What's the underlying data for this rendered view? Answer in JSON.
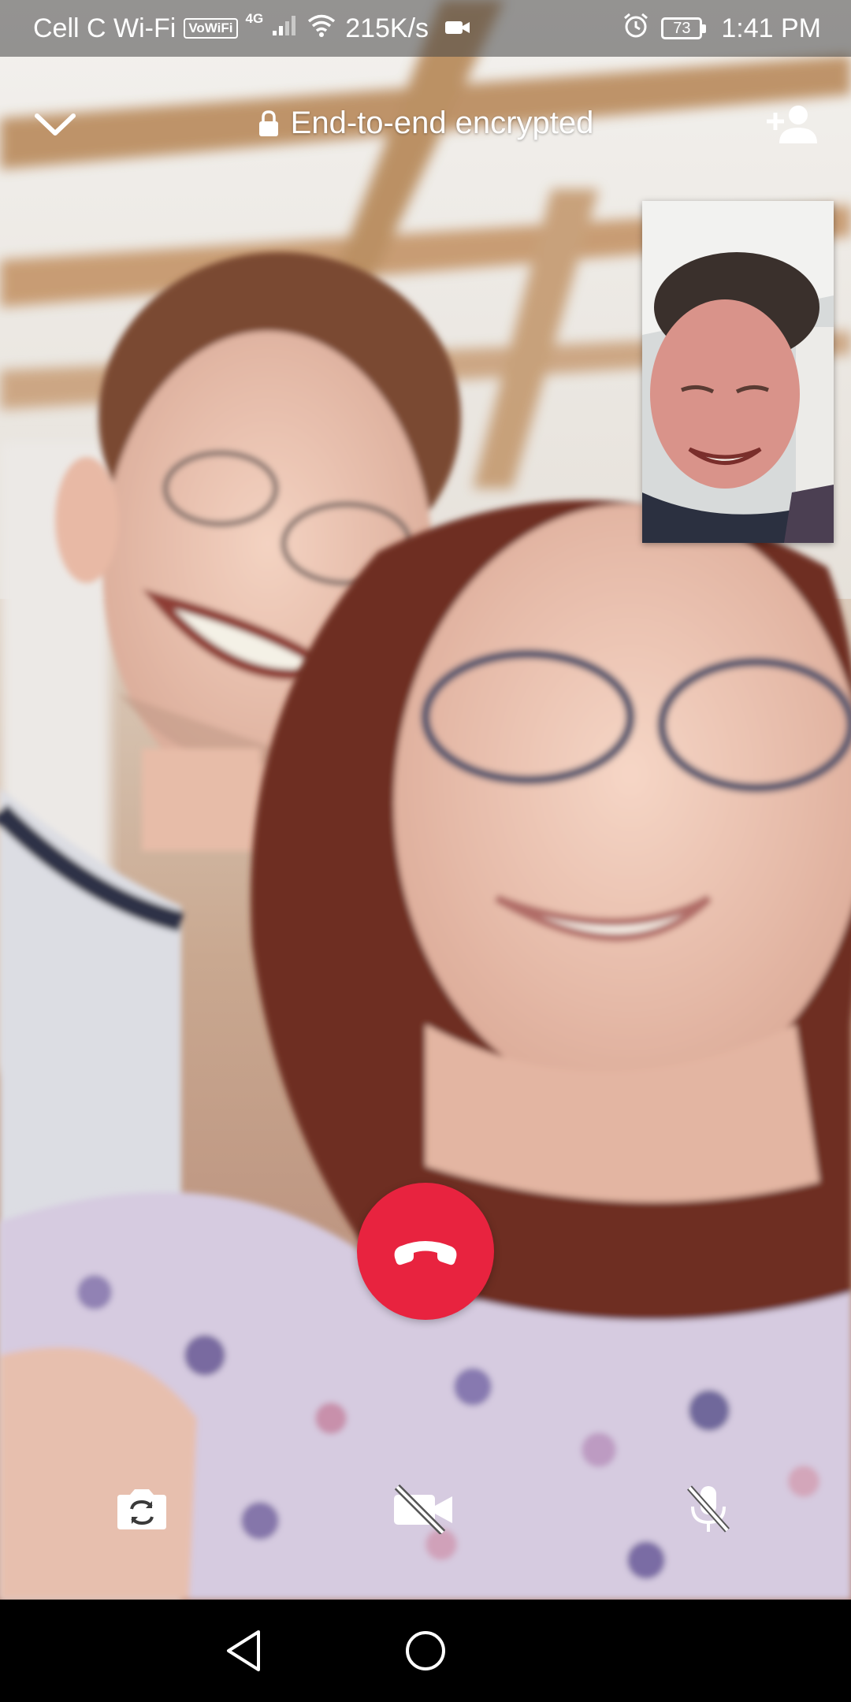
{
  "status_bar": {
    "carrier": "Cell C Wi-Fi",
    "vowifi_badge": "VoWiFi",
    "network_type": "4G",
    "data_speed": "215K/s",
    "battery_level": "73",
    "time": "1:41 PM",
    "icons": [
      "vowifi-icon",
      "signal-icon",
      "wifi-icon",
      "video-status-icon",
      "alarm-icon",
      "battery-icon"
    ]
  },
  "call_header": {
    "encryption_label": "End-to-end encrypted",
    "icons": [
      "chevron-down-icon",
      "lock-icon",
      "add-participant-icon"
    ]
  },
  "controls": {
    "icons": [
      "switch-camera-icon",
      "video-off-icon",
      "mic-off-icon",
      "end-call-icon"
    ]
  },
  "navigation_bar": {
    "icons": [
      "back-icon",
      "home-icon"
    ]
  },
  "colors": {
    "end_call": "#e8233f",
    "status_bar_overlay": "rgba(70,70,70,0.55)",
    "nav_bar": "#000000",
    "icon": "#ffffff"
  }
}
